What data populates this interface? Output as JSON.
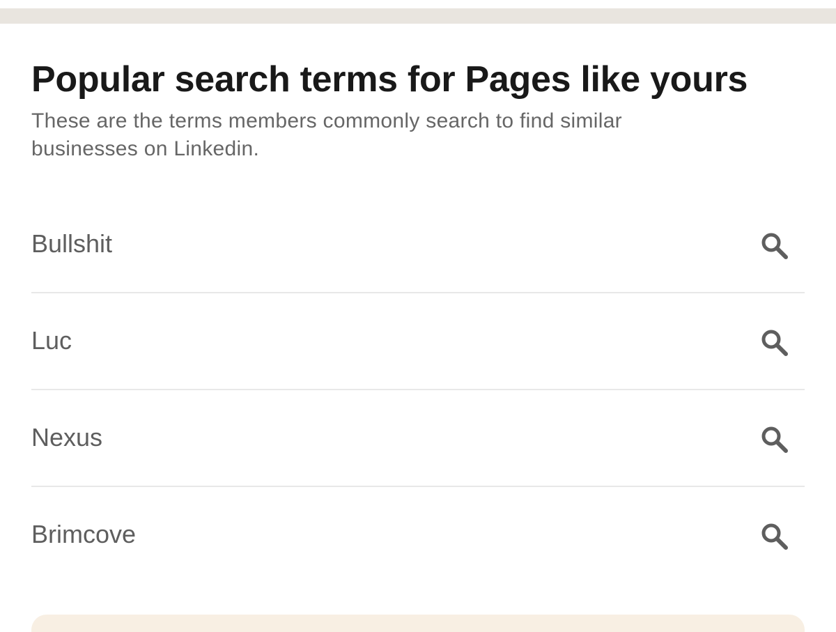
{
  "header": {
    "title": "Popular search terms for Pages like yours",
    "subtitle": "These are the terms members commonly search to find similar businesses on Linkedin."
  },
  "terms": [
    {
      "label": "Bullshit",
      "icon": "search-icon"
    },
    {
      "label": "Luc",
      "icon": "search-icon"
    },
    {
      "label": "Nexus",
      "icon": "search-icon"
    },
    {
      "label": "Brimcove",
      "icon": "search-icon"
    }
  ],
  "colors": {
    "top_band": "#e9e5df",
    "title_text": "#191919",
    "body_text": "#666666",
    "icon": "#5e5e5e",
    "divider": "#e8e8e8",
    "banner_bg": "#f8efe3"
  }
}
